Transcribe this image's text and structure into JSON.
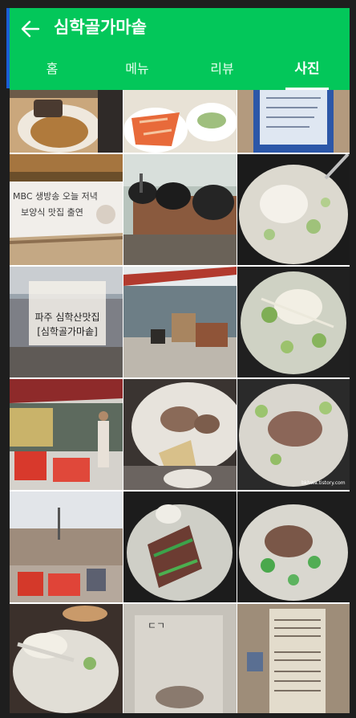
{
  "header": {
    "title": "심학골가마솥",
    "back_icon": "arrow-left-icon"
  },
  "tabs": [
    {
      "label": "홈",
      "active": false
    },
    {
      "label": "메뉴",
      "active": false
    },
    {
      "label": "리뷰",
      "active": false
    },
    {
      "label": "사진",
      "active": true
    }
  ],
  "photos": {
    "p5_sign_line1": "MBC 생방송 오늘 저녁",
    "p5_sign_line2": "보양식 맛집 출연",
    "p8_caption_line1": "파주 심학산맛집",
    "p8_caption_line2": "[심학골가마솥]",
    "p12_watermark": "bkhwa.tistory.com",
    "p17_paper": "ㄷㄱ"
  },
  "colors": {
    "brand_green": "#03c75a",
    "accent_blue": "#1a5fd6"
  }
}
